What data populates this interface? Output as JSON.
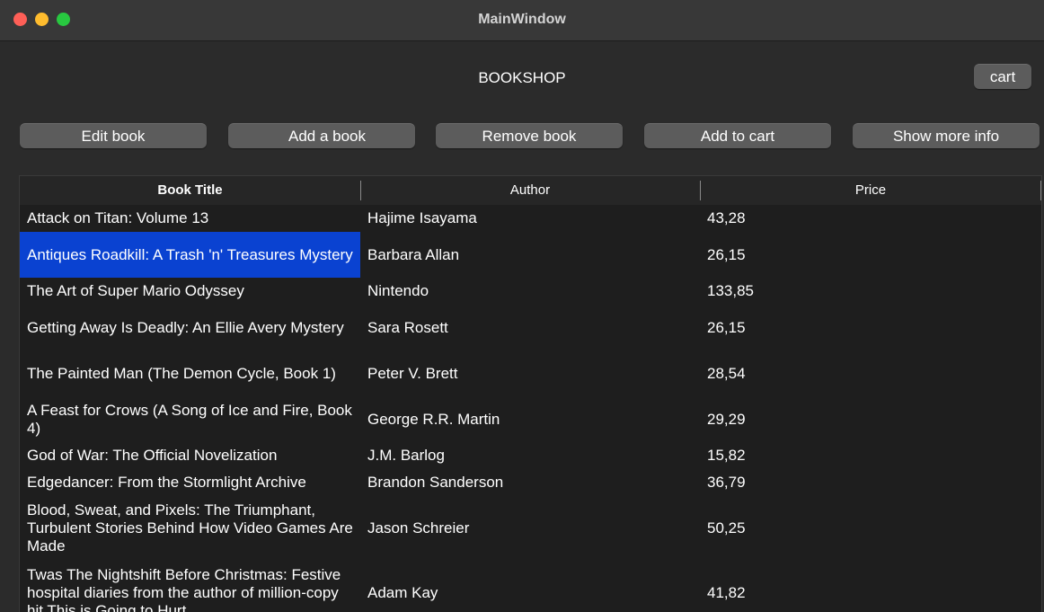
{
  "window": {
    "title": "MainWindow"
  },
  "header": {
    "title": "BOOKSHOP",
    "cart_label": "cart"
  },
  "toolbar": {
    "edit_label": "Edit book",
    "add_label": "Add a book",
    "remove_label": "Remove book",
    "add_to_cart_label": "Add to cart",
    "info_label": "Show more info"
  },
  "table": {
    "columns": [
      "Book Title",
      "Author",
      "Price"
    ],
    "selected_row": 1,
    "rows": [
      {
        "title": "Attack on Titan: Volume 13",
        "author": "Hajime Isayama",
        "price": "43,28"
      },
      {
        "title": "Antiques Roadkill: A Trash 'n' Treasures Mystery",
        "author": "Barbara Allan",
        "price": "26,15"
      },
      {
        "title": "The Art of Super Mario Odyssey",
        "author": "Nintendo",
        "price": "133,85"
      },
      {
        "title": "Getting Away Is Deadly: An Ellie Avery Mystery",
        "author": "Sara Rosett",
        "price": "26,15"
      },
      {
        "title": "The Painted Man (The Demon Cycle, Book 1)",
        "author": "Peter V. Brett",
        "price": "28,54"
      },
      {
        "title": "A Feast for Crows (A Song of Ice and Fire, Book 4)",
        "author": "George R.R. Martin",
        "price": "29,29"
      },
      {
        "title": "God of War: The Official Novelization",
        "author": "J.M. Barlog",
        "price": "15,82"
      },
      {
        "title": "Edgedancer: From the Stormlight Archive",
        "author": "Brandon Sanderson",
        "price": "36,79"
      },
      {
        "title": "Blood, Sweat, and Pixels: The Triumphant, Turbulent Stories Behind How Video Games Are Made",
        "author": "Jason Schreier",
        "price": "50,25"
      },
      {
        "title": "Twas The Nightshift Before Christmas: Festive hospital diaries from the author of million-copy hit This is Going to Hurt",
        "author": "Adam Kay",
        "price": "41,82"
      }
    ]
  }
}
